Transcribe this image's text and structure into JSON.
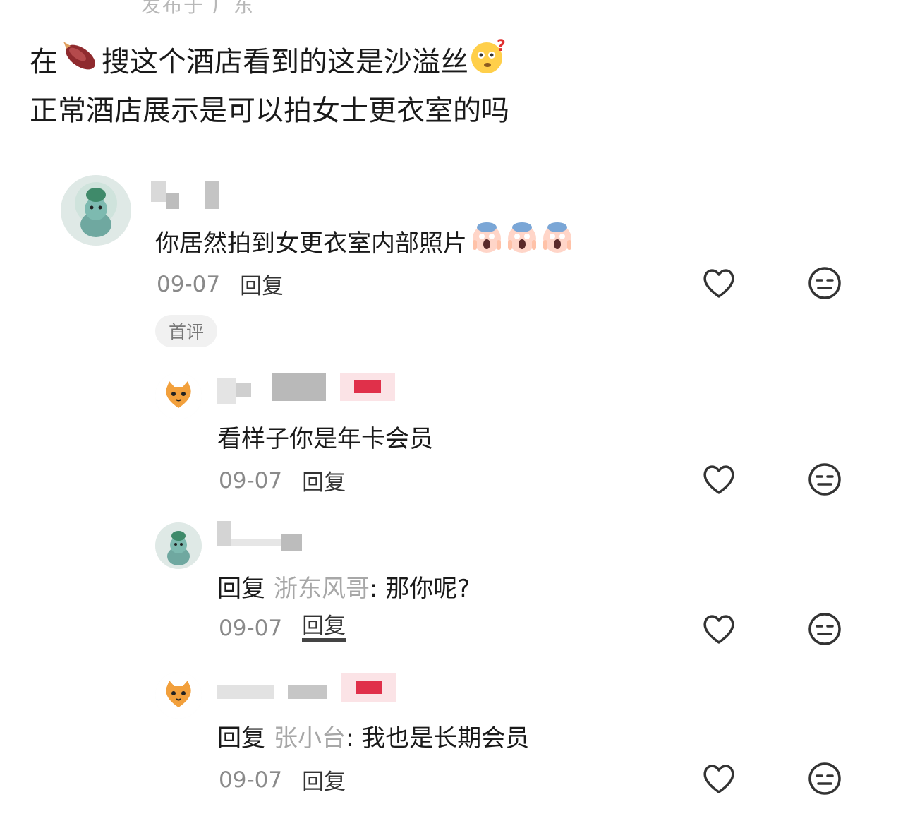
{
  "header_cropped": "发布于 广东",
  "post": {
    "line1_part1": "在",
    "line1_part2": "搜这个酒店看到的这是沙溢丝",
    "line2": "正常酒店展示是可以拍女士更衣室的吗",
    "emoji_sweet_potato": "sweet-potato-icon",
    "emoji_thinking": "thinking-face-icon"
  },
  "comments": [
    {
      "text": "你居然拍到女更衣室内部照片",
      "emoji": "screaming-face-icon",
      "date": "09-07",
      "reply_label": "回复",
      "badge": "首评"
    },
    {
      "text": "看样子你是年卡会员",
      "date": "09-07",
      "reply_label": "回复"
    },
    {
      "prefix": "回复",
      "target": "浙东风哥",
      "text": ": 那你呢?",
      "date": "09-07",
      "reply_label": "回复"
    },
    {
      "prefix": "回复",
      "target": "张小台",
      "text": ": 我也是长期会员",
      "date": "09-07",
      "reply_label": "回复"
    }
  ],
  "colors": {
    "text": "#1a1a1a",
    "meta": "#8a8a8a",
    "muted_name": "#a7a7a7",
    "tag_red": "#e0304a"
  }
}
